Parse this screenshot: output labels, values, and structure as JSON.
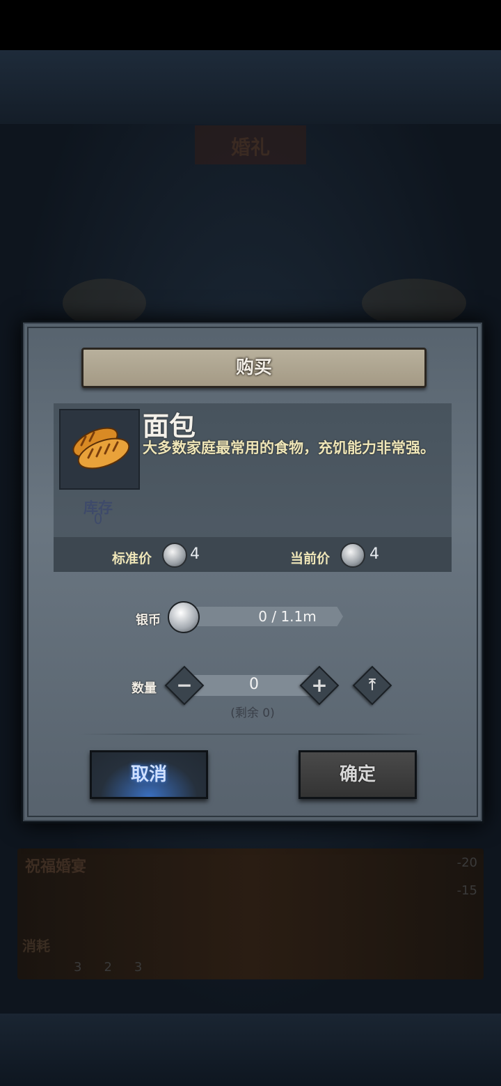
{
  "background": {
    "title": "婚礼",
    "card_title": "祝福婚宴",
    "card_stat_1": "-20",
    "card_stat_2": "-15",
    "consume_label": "消耗",
    "cost_1": "3",
    "cost_2": "2",
    "cost_3": "3"
  },
  "dialog": {
    "title": "购买",
    "item": {
      "name": "面包",
      "description": "大多数家庭最常用的食物，充饥能力非常强。",
      "stock_label": "库存",
      "stock_value": "0",
      "icon": "bread-icon"
    },
    "prices": {
      "standard_label": "标准价",
      "standard_value": "4",
      "current_label": "当前价",
      "current_value": "4",
      "icon": "silver-coin-icon"
    },
    "silver": {
      "label": "银币",
      "value": "0 / 1.1m"
    },
    "quantity": {
      "label": "数量",
      "value": "0",
      "remaining": "(剩余 0)"
    },
    "buttons": {
      "cancel": "取消",
      "confirm": "确定"
    }
  },
  "colors": {
    "accent_blue": "#3a6fc0",
    "desc_text": "#efe6b8",
    "panel": "#6a7681"
  }
}
